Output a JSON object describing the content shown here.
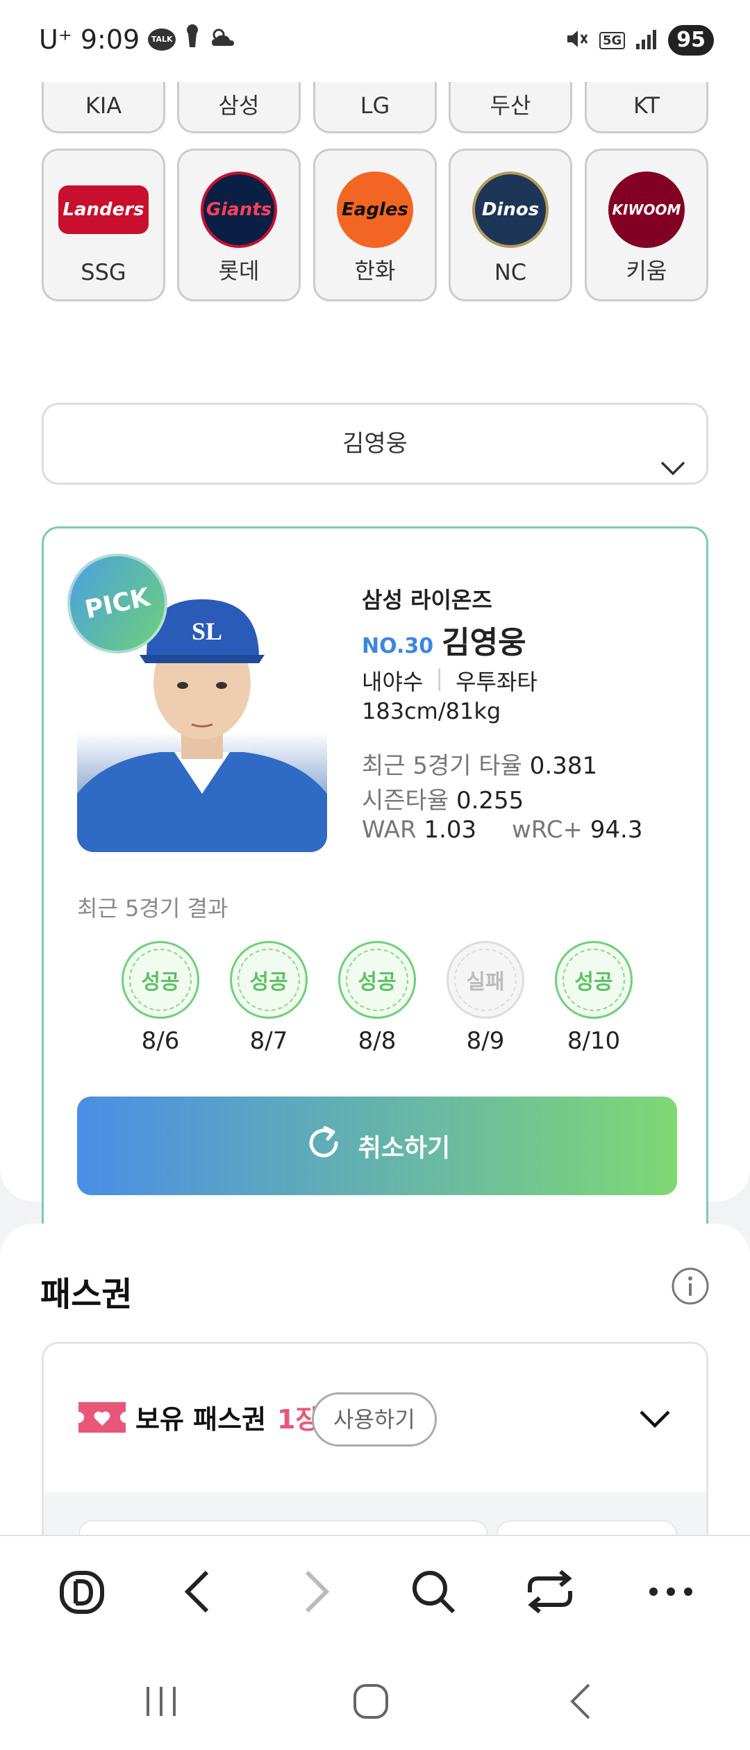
{
  "status_bar": {
    "carrier": "U⁺",
    "time": "9:09",
    "talk_badge": "TALK",
    "battery": "95",
    "network": "5G"
  },
  "teams_row1": [
    "KIA",
    "삼성",
    "LG",
    "두산",
    "KT"
  ],
  "teams_row2": [
    {
      "name": "SSG",
      "logo_text": "Landers",
      "color": "#c8102e"
    },
    {
      "name": "롯데",
      "logo_text": "Giants",
      "color": "#0a1f44"
    },
    {
      "name": "한화",
      "logo_text": "Eagles",
      "color": "#f26522"
    },
    {
      "name": "NC",
      "logo_text": "Dinos",
      "color": "#1d3557"
    },
    {
      "name": "키움",
      "logo_text": "KIWOOM",
      "color": "#820024"
    }
  ],
  "player_select": {
    "value": "김영웅"
  },
  "pick_card": {
    "badge": "PICK",
    "team": "삼성 라이온즈",
    "number": "NO.30",
    "name": "김영웅",
    "position": "내야수",
    "hand": "우투좌타",
    "body": "183cm/81kg",
    "recent5_label": "최근 5경기 타율",
    "recent5_value": "0.381",
    "season_label": "시즌타율",
    "season_value": "0.255",
    "war_label": "WAR",
    "war_value": "1.03",
    "wrc_label": "wRC+",
    "wrc_value": "94.3",
    "results_title": "최근 5경기 결과",
    "results": [
      {
        "label": "성공",
        "date": "8/6",
        "success": true
      },
      {
        "label": "성공",
        "date": "8/7",
        "success": true
      },
      {
        "label": "성공",
        "date": "8/8",
        "success": true
      },
      {
        "label": "실패",
        "date": "8/9",
        "success": false
      },
      {
        "label": "성공",
        "date": "8/10",
        "success": true
      }
    ],
    "cancel_label": "취소하기"
  },
  "pass": {
    "title": "패스권",
    "owned_label": "보유 패스권",
    "owned_count": "1장",
    "use_label": "사용하기"
  },
  "colors": {
    "accent_blue": "#4a8ee6",
    "accent_green": "#7fd874",
    "count_pink": "#e8577a"
  }
}
